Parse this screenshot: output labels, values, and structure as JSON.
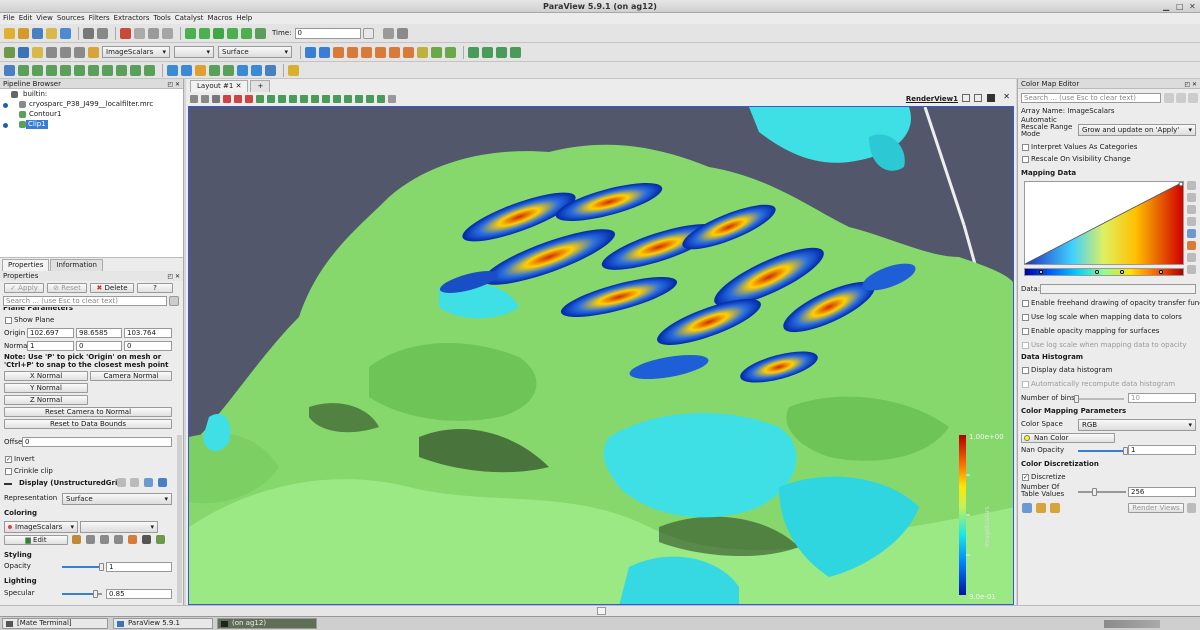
{
  "window": {
    "title": "ParaView 5.9.1 (on ag12)",
    "controls": [
      "▁",
      "□",
      "✕"
    ]
  },
  "menu": [
    "File",
    "Edit",
    "View",
    "Sources",
    "Filters",
    "Extractors",
    "Tools",
    "Catalyst",
    "Macros",
    "Help"
  ],
  "time_toolbar": {
    "label": "Time:",
    "value": "0"
  },
  "variable_toolbar": {
    "array": "ImageScalars",
    "component": "",
    "representation": "Surface"
  },
  "pipeline_browser": {
    "title": "Pipeline Browser",
    "items": [
      {
        "label": "builtin:",
        "selected": false,
        "visible": false
      },
      {
        "label": "cryosparc_P38_J499__localfilter.mrc",
        "selected": false,
        "visible": true
      },
      {
        "label": "Contour1",
        "selected": false,
        "visible": false
      },
      {
        "label": "Clip1",
        "selected": true,
        "visible": true
      }
    ]
  },
  "properties_panel": {
    "tabs": [
      "Properties",
      "Information"
    ],
    "title": "Properties",
    "buttons": {
      "apply": "Apply",
      "reset": "Reset",
      "delete": "Delete",
      "help": "?"
    },
    "search_placeholder": "Search ... (use Esc to clear text)",
    "plane_parameters": "Plane Parameters",
    "show_plane": "Show Plane",
    "origin_label": "Origin",
    "origin": [
      "102.697",
      "98.6585",
      "103.764"
    ],
    "normal_label": "Normal",
    "normal": [
      "1",
      "0",
      "0"
    ],
    "note": "Note: Use 'P' to pick 'Origin' on mesh or 'Ctrl+P' to snap to the closest mesh point",
    "x_normal": "X Normal",
    "camera_normal": "Camera Normal",
    "y_normal": "Y Normal",
    "z_normal": "Z Normal",
    "reset_camera_to_normal": "Reset Camera to Normal",
    "reset_to_data_bounds": "Reset to Data Bounds",
    "offset_label": "Offset",
    "offset": "0",
    "invert": "Invert",
    "crinkle_clip": "Crinkle clip",
    "display_header": "Display (UnstructuredGrid",
    "representation_label": "Representation",
    "representation": "Surface",
    "coloring_section": "Coloring",
    "coloring_array": "ImageScalars",
    "coloring_component": "",
    "edit": "Edit",
    "styling_section": "Styling",
    "opacity_label": "Opacity",
    "opacity": "1",
    "opacity_level": 1.0,
    "lighting_section": "Lighting",
    "specular_label": "Specular",
    "specular": "0.85",
    "specular_level": 0.85
  },
  "layout": {
    "tab": "Layout #1",
    "new_tab": "+",
    "view_label": "RenderView1",
    "colorbar": {
      "max_label": "1.00e+00",
      "min_label": "9.0e-01",
      "title": "ImageScalars"
    }
  },
  "color_map_editor": {
    "title": "Color Map Editor",
    "search_placeholder": "Search ... (use Esc to clear text)",
    "array_name": "Array Name: ImageScalars",
    "auto_rescale_label": "Automatic Rescale Range Mode",
    "auto_rescale_value": "Grow and update on 'Apply'",
    "interpret_categories": "Interpret Values As Categories",
    "rescale_on_visibility": "Rescale On Visibility Change",
    "mapping_data": "Mapping Data",
    "data_label": "Data:",
    "freehand": "Enable freehand drawing of opacity transfer function",
    "log_scale": "Use log scale when mapping data to colors",
    "opacity_surfaces": "Enable opacity mapping for surfaces",
    "log_scale_opacity": "Use log scale when mapping data to opacity",
    "data_histogram": "Data Histogram",
    "display_histogram": "Display data histogram",
    "auto_recompute": "Automatically recompute data histogram",
    "num_bins_label": "Number of bins:",
    "num_bins": "10",
    "color_mapping_params": "Color Mapping Parameters",
    "color_space_label": "Color Space",
    "color_space": "RGB",
    "nan_color": "Nan Color",
    "nan_opacity_label": "Nan Opacity",
    "nan_opacity": "1",
    "nan_opacity_level": 1.0,
    "color_discretization": "Color Discretization",
    "discretize": "Discretize",
    "num_table_values_label": "Number Of Table Values",
    "num_table_values": "256",
    "render_views": "Render Views"
  },
  "taskbar": [
    "[Mate Terminal]",
    "ParaView 5.9.1",
    "(on ag12)"
  ],
  "colors": {
    "accent": "#3a7dd4",
    "background_view": "#52576b",
    "surface_green": "#8ee07a",
    "surface_cyan": "#3ee0e6"
  }
}
